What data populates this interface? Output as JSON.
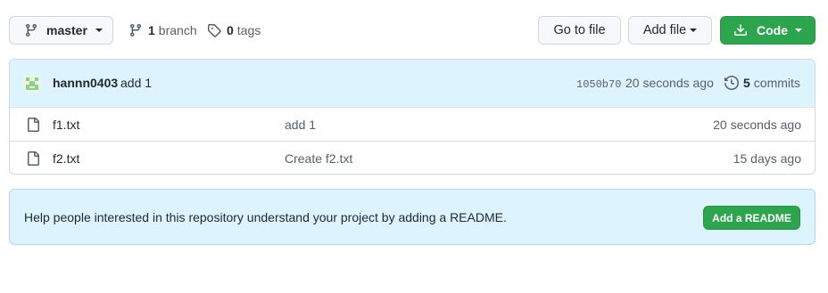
{
  "toolbar": {
    "branch_selector": "master",
    "branches_count": "1",
    "branches_word": "branch",
    "tags_count": "0",
    "tags_word": "tags",
    "go_to_file": "Go to file",
    "add_file": "Add file",
    "code": "Code"
  },
  "latest_commit": {
    "author": "hannn0403",
    "message": "add 1",
    "sha": "1050b70",
    "time": "20 seconds ago",
    "commits_count": "5",
    "commits_word": "commits"
  },
  "files": [
    {
      "name": "f1.txt",
      "message": "add 1",
      "age": "20 seconds ago"
    },
    {
      "name": "f2.txt",
      "message": "Create f2.txt",
      "age": "15 days ago"
    }
  ],
  "readme": {
    "text": "Help people interested in this repository understand your project by adding a README.",
    "button": "Add a README"
  },
  "colors": {
    "primary_green": "#2da44e",
    "header_blue": "#ddf4ff",
    "border": "#d0d7de"
  },
  "icons": {
    "branch": "git-branch-icon",
    "tag": "tag-icon",
    "download": "download-icon",
    "history": "history-icon",
    "file": "file-icon"
  }
}
